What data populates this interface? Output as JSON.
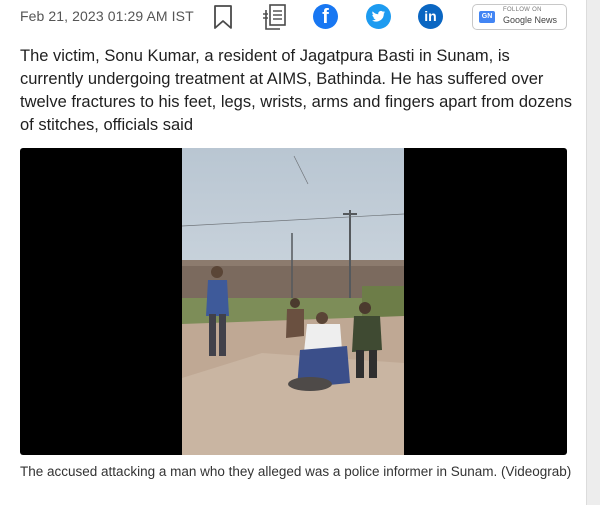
{
  "article": {
    "dateline": "Feb 21, 2023 01:29 AM IST",
    "summary": "The victim, Sonu Kumar, a resident of Jagatpura Basti in Sunam, is currently undergoing treatment at AIMS, Bathinda. He has suffered over twelve fractures to his feet, legs, wrists, arms and fingers apart from dozens of stitches, officials said",
    "caption": "The accused attacking a man who they alleged was a police informer in Sunam. (Videograb)"
  },
  "share": {
    "facebook_glyph": "f",
    "linkedin_glyph": "in",
    "google_news": {
      "follow_label": "FOLLOW ON",
      "name": "Google News",
      "badge": "GN"
    }
  },
  "icons": [
    "bookmark-icon",
    "copy-outline-icon",
    "facebook-icon",
    "twitter-icon",
    "linkedin-icon",
    "google-news-icon"
  ],
  "colors": {
    "facebook": "#1877f2",
    "twitter": "#1d9bf0",
    "linkedin": "#0a66c2",
    "google_news_badge": "#4285f4",
    "text": "#1f1f1f",
    "muted": "#555555"
  }
}
